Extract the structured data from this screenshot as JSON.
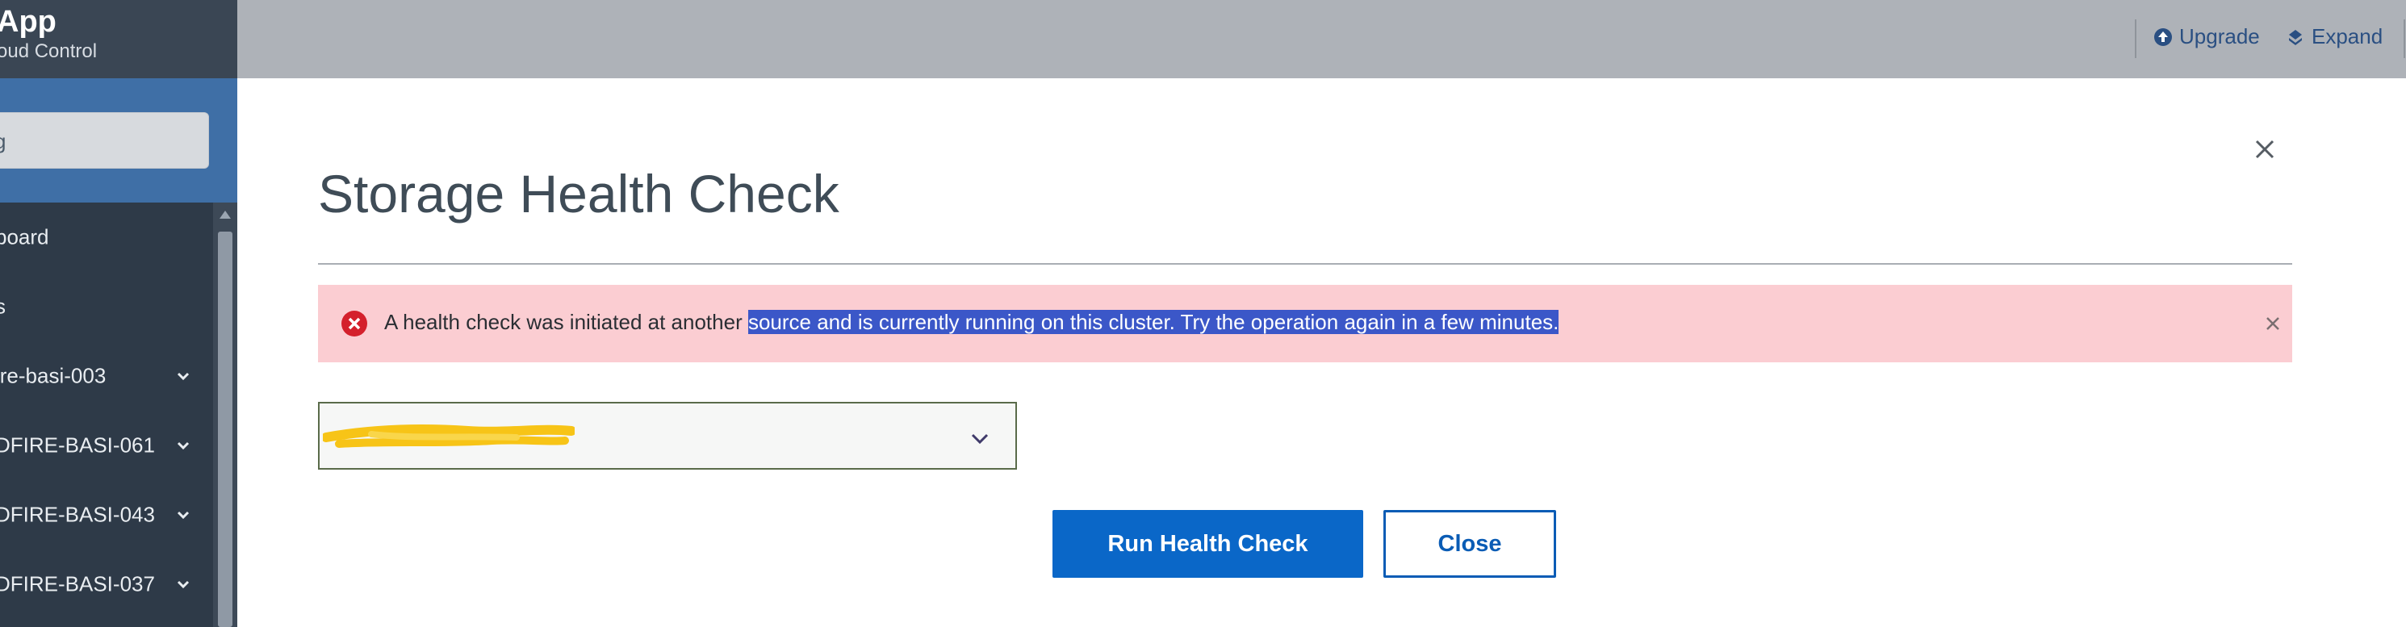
{
  "brand": {
    "title": "App",
    "subtitle": "oud Control"
  },
  "search": {
    "value": "g"
  },
  "sidebar": {
    "items": [
      {
        "label": "board",
        "expandable": false
      },
      {
        "label": "s",
        "expandable": false
      },
      {
        "label": "ire-basi-003",
        "expandable": true
      },
      {
        "label": "DFIRE-BASI-061",
        "expandable": true
      },
      {
        "label": "DFIRE-BASI-043",
        "expandable": true
      },
      {
        "label": "DFIRE-BASI-037",
        "expandable": true
      }
    ]
  },
  "header": {
    "upgrade_label": "Upgrade",
    "expand_label": "Expand"
  },
  "modal": {
    "title": "Storage Health Check",
    "alert": {
      "text_plain": "A health check was initiated at another ",
      "text_selected": "source and is currently running on this cluster. Try the operation again in a few minutes."
    },
    "select": {
      "value": ""
    },
    "run_label": "Run Health Check",
    "close_label": "Close"
  },
  "colors": {
    "sidebar_bg": "#2e3a48",
    "search_band": "#3f6fa6",
    "header_bg": "#aeb2b8",
    "alert_bg": "#fbcdd2",
    "alert_icon": "#d4202c",
    "primary": "#0a67c8",
    "redaction": "#f7c417"
  },
  "icons": {
    "upgrade": "arrow-up-circle-icon",
    "expand": "expand-icon",
    "modal_close": "close-icon",
    "alert": "error-circle-icon",
    "alert_close": "close-icon",
    "select_chevron": "chevron-down-icon",
    "nav_chevron": "chevron-down-icon"
  }
}
